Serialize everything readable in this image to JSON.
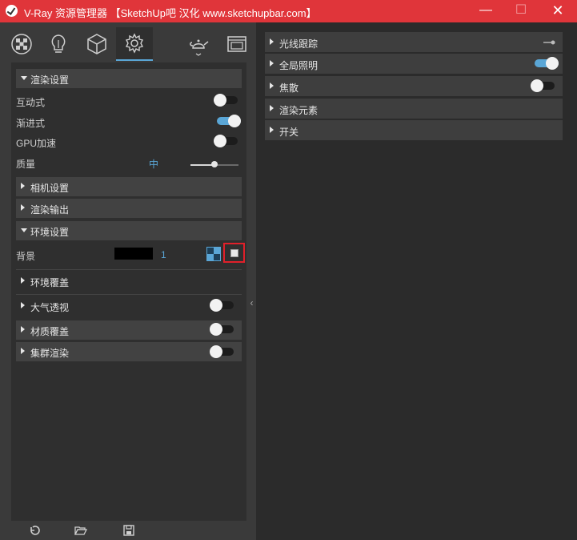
{
  "window": {
    "title": "V-Ray 资源管理器 【SketchUp吧 汉化 www.sketchupbar.com】",
    "minimize": "—",
    "maximize": "☐",
    "close": "✕"
  },
  "toolbar": {
    "tabs": [
      {
        "icon": "materials-icon"
      },
      {
        "icon": "lights-icon"
      },
      {
        "icon": "geometry-icon"
      },
      {
        "icon": "settings-icon",
        "active": true
      }
    ],
    "teapot_icon": "teapot-render-icon",
    "frame_icon": "frame-buffer-icon"
  },
  "left": {
    "render_settings": {
      "label": "渲染设置",
      "interactive": {
        "label": "互动式",
        "on": false
      },
      "progressive": {
        "label": "渐进式",
        "on": true
      },
      "gpu": {
        "label": "GPU加速",
        "on": false
      },
      "quality": {
        "label": "质量",
        "value": "中",
        "level": 0.5
      }
    },
    "camera": {
      "label": "相机设置"
    },
    "output": {
      "label": "渲染输出"
    },
    "environment": {
      "label": "环境设置",
      "background": {
        "label": "背景",
        "color": "#000000",
        "intensity": "1"
      }
    },
    "env_override": {
      "label": "环境覆盖"
    },
    "aerial": {
      "label": "大气透视",
      "on": false
    },
    "material_override": {
      "label": "材质覆盖",
      "on": false
    },
    "swarm": {
      "label": "集群渲染",
      "on": false
    }
  },
  "bottom": {
    "icons": [
      "undo-icon",
      "open-folder-icon",
      "save-icon"
    ]
  },
  "collapse": "‹",
  "right": {
    "raytrace": {
      "label": "光线跟踪"
    },
    "gi": {
      "label": "全局照明",
      "on": true
    },
    "caustics": {
      "label": "焦散",
      "on": false
    },
    "render_elements": {
      "label": "渲染元素"
    },
    "switches": {
      "label": "开关"
    }
  },
  "colors": {
    "titlebar": "#e0353a",
    "accent": "#5aa6d6",
    "highlight": "#e0202a"
  }
}
